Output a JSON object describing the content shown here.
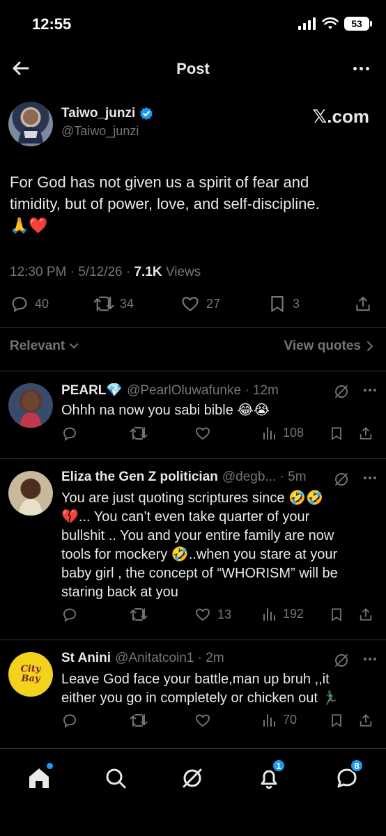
{
  "status_bar": {
    "time": "12:55",
    "battery": "53"
  },
  "header": {
    "title": "Post"
  },
  "post": {
    "author_name": "Taiwo_junzi",
    "author_handle": "@Taiwo_junzi",
    "watermark": "𝕏.com",
    "text_line1": "For God has not given us a spirit of fear and",
    "text_line2": "timidity, but of power, love, and self-discipline.",
    "text_emoji": "🙏❤️",
    "time": "12:30 PM",
    "date": "5/12/26",
    "views_count": "7.1K",
    "views_label": "Views",
    "replies": "40",
    "reposts": "34",
    "likes": "27",
    "bookmarks": "3"
  },
  "filter": {
    "left": "Relevant",
    "right": "View quotes"
  },
  "replies": [
    {
      "name": "PEARL💎",
      "handle": "@PearlOluwafunke · 12m",
      "text": "Ohhh na now you sabi bible 😂😭",
      "likes": "",
      "views": "108"
    },
    {
      "name": "Eliza the Gen Z politician",
      "handle": "@degb... · 5m",
      "line1": "You are just quoting scriptures since 🤣🤣",
      "line2": "💔... You can’t even take quarter of your",
      "line3": "bullshit .. You and your entire family are now",
      "line4": "tools for mockery 🤣..when you stare at your",
      "line5": "baby girl , the concept of “WHORISM” will be",
      "line6": "staring back at you",
      "likes": "13",
      "views": "192"
    },
    {
      "name": "St Anini",
      "handle": "@Anitatcoin1 · 2m",
      "line1": "Leave God face your battle,man up bruh ,,it",
      "line2": "either you go in completely or chicken out 🏃🏿‍♂️",
      "likes": "",
      "views": "70",
      "avatar_text": "City Bay"
    }
  ],
  "tabbar": {
    "notifications_badge": "1",
    "messages_badge": "8"
  },
  "colors": {
    "accent": "#1d9bf0",
    "muted": "#71767b",
    "text": "#e7e9ea",
    "divider": "#2f3336"
  }
}
